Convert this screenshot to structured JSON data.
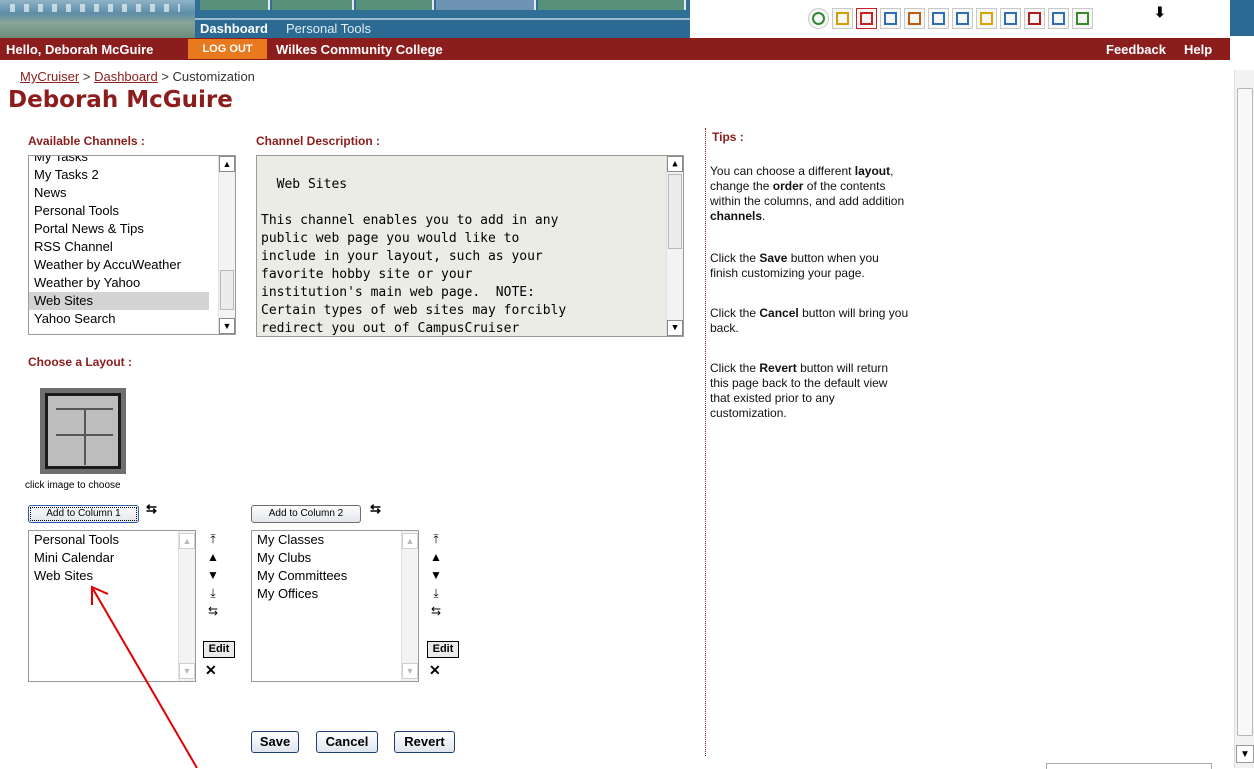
{
  "nav": {
    "tabs": [
      "Dashboard",
      "Personal Tools"
    ],
    "toolbar_icons": [
      "refresh-icon",
      "sound-icon",
      "mail-icon",
      "compose-icon",
      "window-icon",
      "calendar-icon",
      "notes-icon",
      "folder-icon",
      "copy-icon",
      "book-icon",
      "image-icon",
      "person-icon"
    ],
    "more_label": "⬇"
  },
  "userbar": {
    "hello": "Hello, Deborah McGuire",
    "logout": "LOG OUT",
    "college": "Wilkes Community College",
    "feedback": "Feedback",
    "help": "Help"
  },
  "breadcrumb": {
    "items": [
      "MyCruiser",
      "Dashboard",
      "Customization"
    ],
    "separator": ">"
  },
  "page_title": "Deborah McGuire",
  "available_channels": {
    "label": "Available Channels :",
    "items": [
      "My Tasks",
      "My Tasks 2",
      "News",
      "Personal Tools",
      "Portal News & Tips",
      "RSS Channel",
      "Weather by AccuWeather",
      "Weather by Yahoo",
      "Web Sites",
      "Yahoo Search"
    ],
    "selected": "Web Sites"
  },
  "channel_description": {
    "label": "Channel Description :",
    "text": "Web Sites\n\nThis channel enables you to add in any\npublic web page you would like to\ninclude in your layout, such as your\nfavorite hobby site or your\ninstitution's main web page.  NOTE:\nCertain types of web sites may forcibly\nredirect you out of CampusCruiser"
  },
  "tips": {
    "label": "Tips :",
    "p1_parts": [
      "You can choose a different",
      "layout",
      ", change the",
      "order",
      "of the contents within the columns, and add addition",
      "channels",
      "."
    ],
    "p2_parts": [
      "Click the",
      "Save",
      "button when you finish customizing your page."
    ],
    "p3_parts": [
      "Click the",
      "Cancel",
      "button will bring you back."
    ],
    "p4_parts": [
      "Click the",
      "Revert",
      "button will return this page back to the default view that existed prior to any customization."
    ]
  },
  "layout": {
    "label": "Choose a Layout :",
    "hint": "click image to choose"
  },
  "column1": {
    "button": "Add to Column 1",
    "items": [
      "Personal Tools",
      "Mini Calendar",
      "Web Sites"
    ]
  },
  "column2": {
    "button": "Add to Column 2",
    "items": [
      "My Classes",
      "My Clubs",
      "My Committees",
      "My Offices"
    ]
  },
  "side_controls": {
    "move_top": "⤒",
    "move_up": "▲",
    "move_down": "▼",
    "move_bottom": "⤓",
    "swap": "⇆",
    "edit": "Edit",
    "remove": "✕"
  },
  "actions": {
    "save": "Save",
    "cancel": "Cancel",
    "revert": "Revert"
  },
  "colors": {
    "brand_red": "#8b1d1d",
    "nav_blue": "#2a6a93",
    "logout_orange": "#e8791f",
    "annotation_arrow": "#e00000"
  }
}
